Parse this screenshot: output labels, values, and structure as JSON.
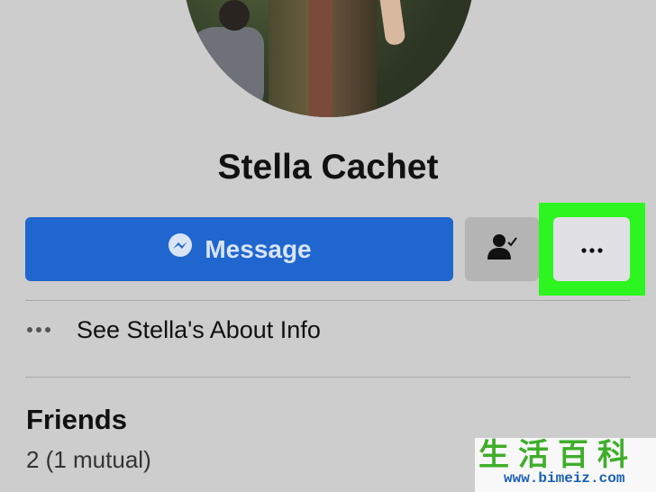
{
  "profile": {
    "name": "Stella Cachet"
  },
  "actions": {
    "message_label": "Message",
    "friend_icon": "friend-check-icon",
    "more_icon": "more-dots-icon",
    "message_icon": "messenger-icon",
    "highlight_color": "#2cf51f",
    "message_color": "#1f67cf"
  },
  "about": {
    "label": "See Stella's About Info",
    "icon": "more-dots-icon"
  },
  "friends": {
    "title": "Friends",
    "count": "2 (1 mutual)"
  },
  "watermark": {
    "chars": "生活百科",
    "url": "www.bimeiz.com"
  }
}
